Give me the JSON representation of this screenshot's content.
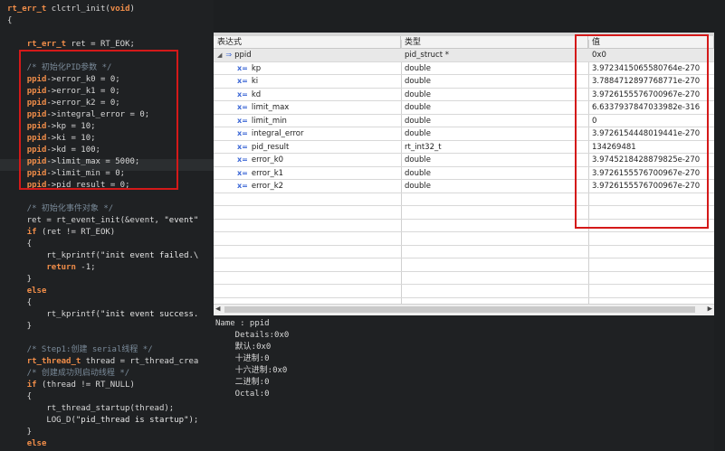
{
  "code": {
    "lines": [
      "rt_err_t clctrl_init(void)",
      "{",
      "",
      "    rt_err_t ret = RT_EOK;",
      "",
      "    /* 初始化PID参数 */",
      "    ppid->error_k0 = 0;",
      "    ppid->error_k1 = 0;",
      "    ppid->error_k2 = 0;",
      "    ppid->integral_error = 0;",
      "    ppid->kp = 10;",
      "    ppid->ki = 10;",
      "    ppid->kd = 100;",
      "    ppid->limit_max = 5000;",
      "    ppid->limit_min = 0;",
      "    ppid->pid_result = 0;",
      "",
      "    /* 初始化事件对象 */",
      "    ret = rt_event_init(&event, \"event\"",
      "    if (ret != RT_EOK)",
      "    {",
      "        rt_kprintf(\"init event failed.\\",
      "        return -1;",
      "    }",
      "    else",
      "    {",
      "        rt_kprintf(\"init event success.",
      "    }",
      "",
      "    /* Step1:创建 serial线程 */",
      "    rt_thread_t thread = rt_thread_crea",
      "    /* 创建成功则启动线程 */",
      "    if (thread != RT_NULL)",
      "    {",
      "        rt_thread_startup(thread);",
      "        LOG_D(\"pid_thread is startup\");",
      "    }",
      "    else"
    ]
  },
  "watch": {
    "headers": [
      "表达式",
      "类型",
      "值"
    ],
    "rows": [
      {
        "name": "ppid",
        "type": "pid_struct *",
        "value": "0x0",
        "root": true
      },
      {
        "name": "kp",
        "type": "double",
        "value": "3.9723415065580764e-270"
      },
      {
        "name": "ki",
        "type": "double",
        "value": "3.7884712897768771e-270"
      },
      {
        "name": "kd",
        "type": "double",
        "value": "3.9726155576700967e-270"
      },
      {
        "name": "limit_max",
        "type": "double",
        "value": "6.6337937847033982e-316"
      },
      {
        "name": "limit_min",
        "type": "double",
        "value": "0"
      },
      {
        "name": "integral_error",
        "type": "double",
        "value": "3.9726154448019441e-270"
      },
      {
        "name": "pid_result",
        "type": "rt_int32_t",
        "value": "134269481"
      },
      {
        "name": "error_k0",
        "type": "double",
        "value": "3.9745218428879825e-270"
      },
      {
        "name": "error_k1",
        "type": "double",
        "value": "3.9726155576700967e-270"
      },
      {
        "name": "error_k2",
        "type": "double",
        "value": "3.9726155576700967e-270"
      }
    ],
    "field_icon": "x=",
    "pointer_icon": "⇒"
  },
  "details": {
    "lines": [
      "Name : ppid",
      "    Details:0x0",
      "    默认:0x0",
      "    十进制:0",
      "    十六进制:0x0",
      "    二进制:0",
      "    Octal:0"
    ]
  },
  "colors": {
    "highlight_box": "#d41919",
    "keyword": "#f08d49",
    "icon": "#3c67d6"
  }
}
